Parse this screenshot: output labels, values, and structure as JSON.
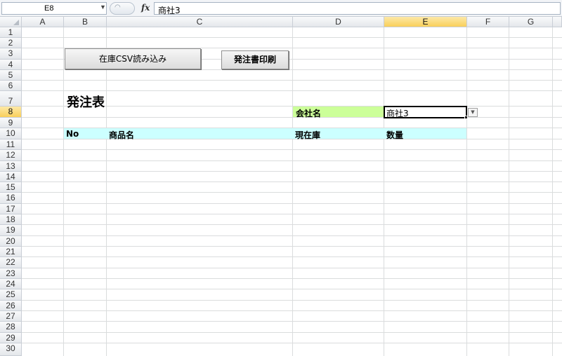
{
  "formula_bar": {
    "name_box": "E8",
    "formula": "商社3"
  },
  "columns": [
    "A",
    "B",
    "C",
    "D",
    "E",
    "F",
    "G"
  ],
  "selected_column": "E",
  "rows": [
    "1",
    "2",
    "3",
    "4",
    "5",
    "6",
    "7",
    "8",
    "9",
    "10",
    "11",
    "12",
    "13",
    "14",
    "15",
    "16",
    "17",
    "18",
    "19",
    "20",
    "21",
    "22",
    "23",
    "24",
    "25",
    "26",
    "27",
    "28",
    "29",
    "30"
  ],
  "selected_row": "8",
  "buttons": {
    "import_csv": "在庫CSV読み込み",
    "print_order": "発注書印刷"
  },
  "sheet": {
    "title": "発注表",
    "company_label": "会社名",
    "company_value": "商社3",
    "headers": {
      "no": "No",
      "product": "商品名",
      "stock": "現在庫",
      "qty": "数量"
    }
  },
  "colors": {
    "header_fill": "#ccffff",
    "label_fill": "#ccff99",
    "selected_header": "#f9cf5a"
  }
}
